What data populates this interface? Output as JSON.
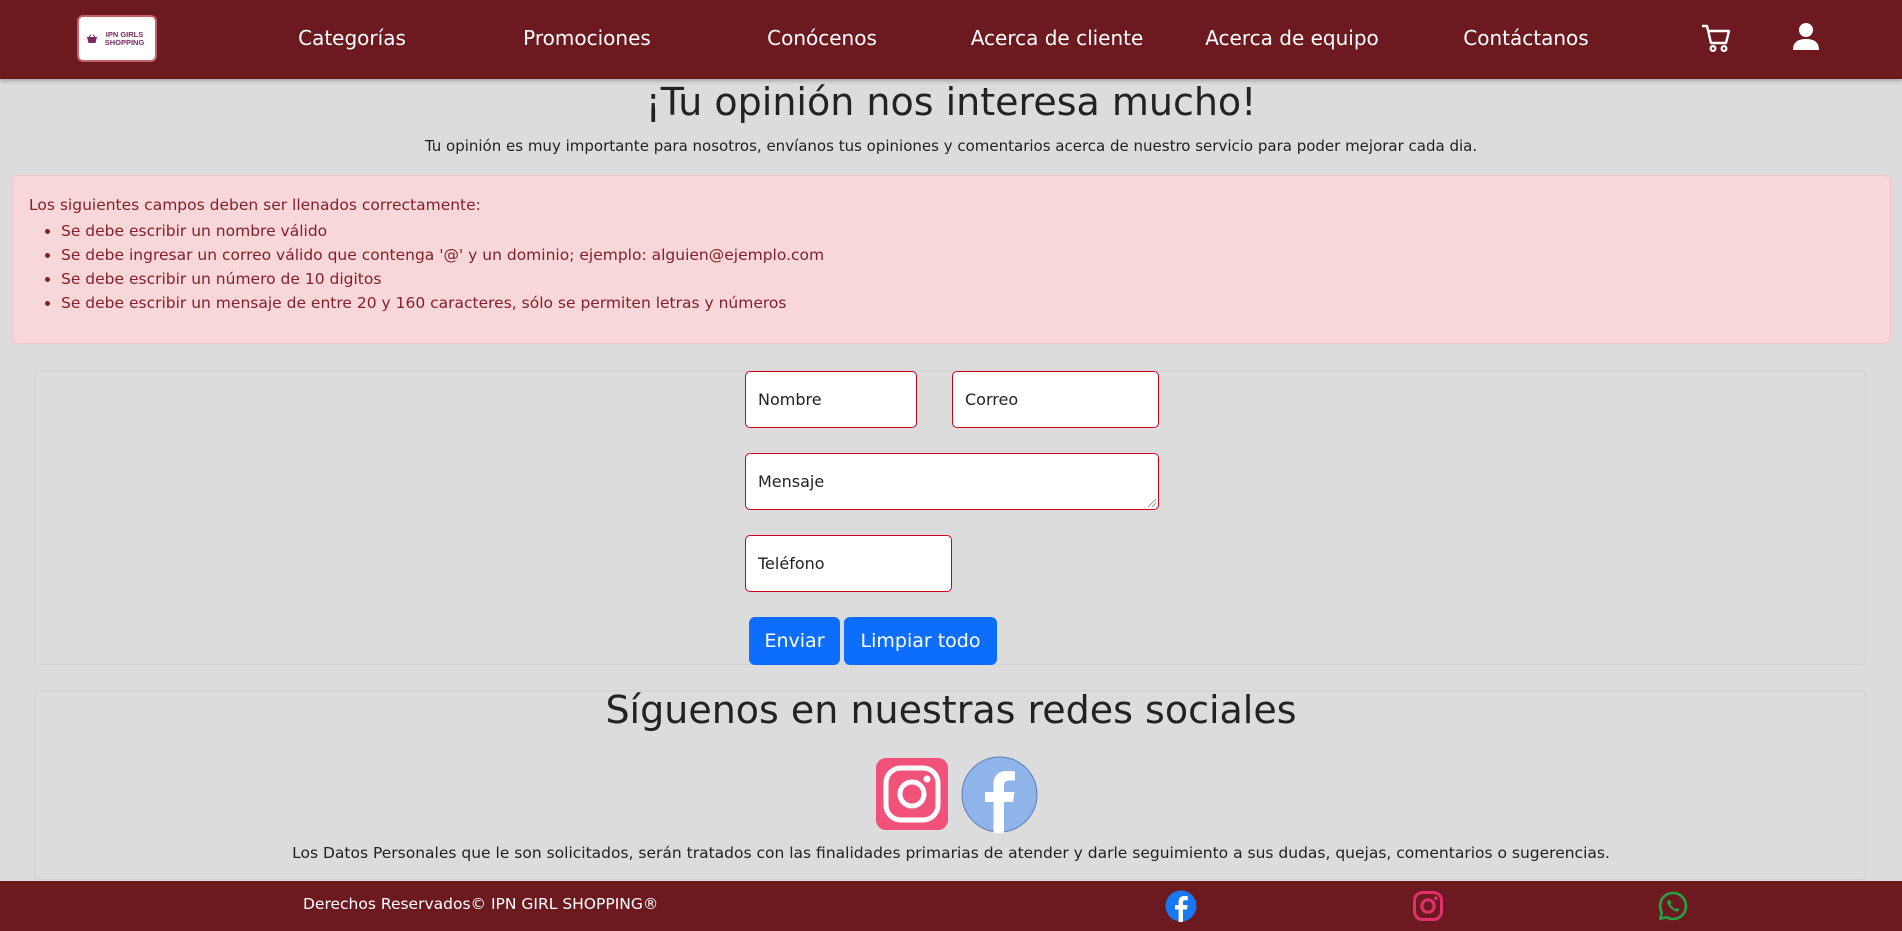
{
  "brand": {
    "logo_text": "IPN GIRLS SHOPPING"
  },
  "nav": {
    "items": [
      {
        "label": "Categorías"
      },
      {
        "label": "Promociones"
      },
      {
        "label": "Conócenos"
      },
      {
        "label": "Acerca de cliente"
      },
      {
        "label": "Acerca de equipo"
      },
      {
        "label": "Contáctanos"
      }
    ],
    "icons": [
      "cart-icon",
      "user-icon"
    ]
  },
  "main": {
    "title": "¡Tu opinión nos interesa mucho!",
    "subtitle": "Tu opinión es muy importante para nosotros, envíanos tus opiniones y comentarios acerca de nuestro servicio para poder mejorar cada dia."
  },
  "alert": {
    "heading": "Los siguientes campos deben ser llenados correctamente:",
    "items": [
      "Se debe escribir un nombre válido",
      "Se debe ingresar un correo válido que contenga '@' y un dominio; ejemplo: alguien@ejemplo.com",
      "Se debe escribir un número de 10 digitos",
      "Se debe escribir un mensaje de entre 20 y 160 caracteres, sólo se permiten letras y números"
    ]
  },
  "form": {
    "name_placeholder": "Nombre",
    "email_placeholder": "Correo",
    "message_placeholder": "Mensaje",
    "phone_placeholder": "Teléfono",
    "submit_label": "Enviar",
    "clear_label": "Limpiar todo",
    "invalid_border_color": "#d0021b",
    "button_color": "#0d6efd"
  },
  "social": {
    "title": "Síguenos en nuestras redes sociales",
    "icons": [
      "instagram-icon",
      "facebook-icon"
    ],
    "privacy_note": "Los Datos Personales que le son solicitados, serán tratados con las finalidades primarias de atender y darle seguimiento a sus dudas, quejas, comentarios o sugerencias."
  },
  "footer": {
    "copyright": "Derechos Reservados© IPN GIRL SHOPPING®",
    "icons": [
      "facebook-icon",
      "instagram-icon",
      "whatsapp-icon"
    ]
  },
  "colors": {
    "brand": "#6c1a1f",
    "alert_bg": "#f8d7da",
    "alert_text": "#842029",
    "page_bg": "#dcdcdc"
  }
}
